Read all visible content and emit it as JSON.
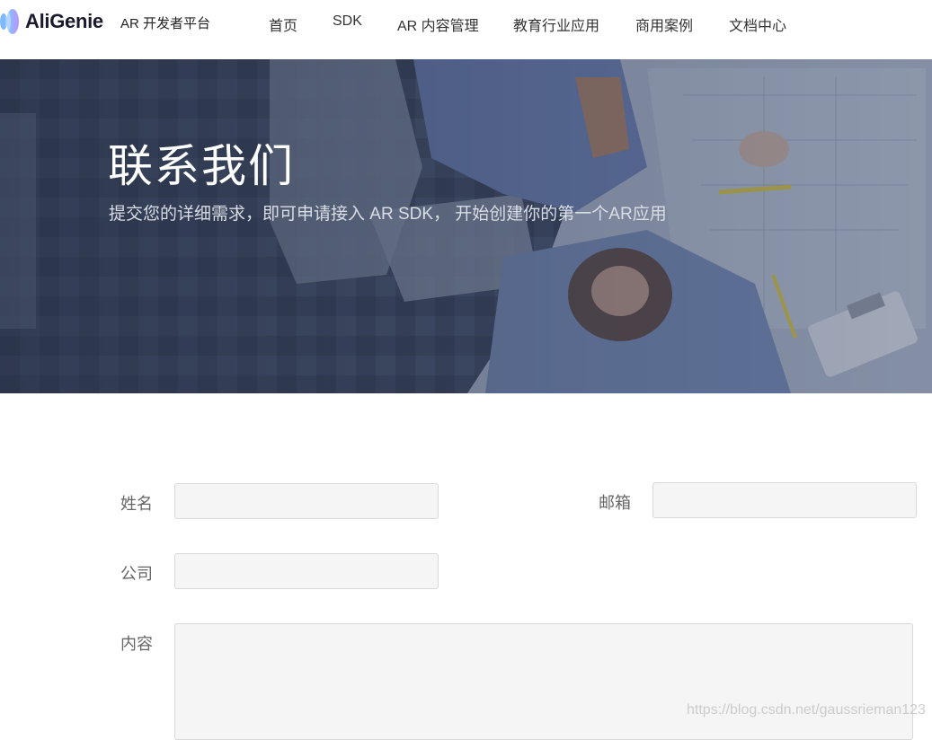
{
  "header": {
    "brand": "AliGenie",
    "subtitle": "AR 开发者平台",
    "nav": [
      {
        "label": "首页"
      },
      {
        "label": "SDK"
      },
      {
        "label": "AR 内容管理"
      },
      {
        "label": "教育行业应用"
      },
      {
        "label": "商用案例"
      },
      {
        "label": "文档中心"
      }
    ]
  },
  "hero": {
    "title": "联系我们",
    "subtitle": "提交您的详细需求，即可申请接入 AR SDK， 开始创建你的第一个AR应用"
  },
  "form": {
    "name_label": "姓名",
    "name_value": "",
    "email_label": "邮箱",
    "email_value": "",
    "company_label": "公司",
    "company_value": "",
    "content_label": "内容",
    "content_value": ""
  },
  "watermark": "https://blog.csdn.net/gaussrieman123",
  "colors": {
    "logo_left": "#6ec6ff",
    "logo_right": "#b388ff",
    "hero_overlay": "#3d4a63",
    "input_bg": "#f5f5f5"
  }
}
